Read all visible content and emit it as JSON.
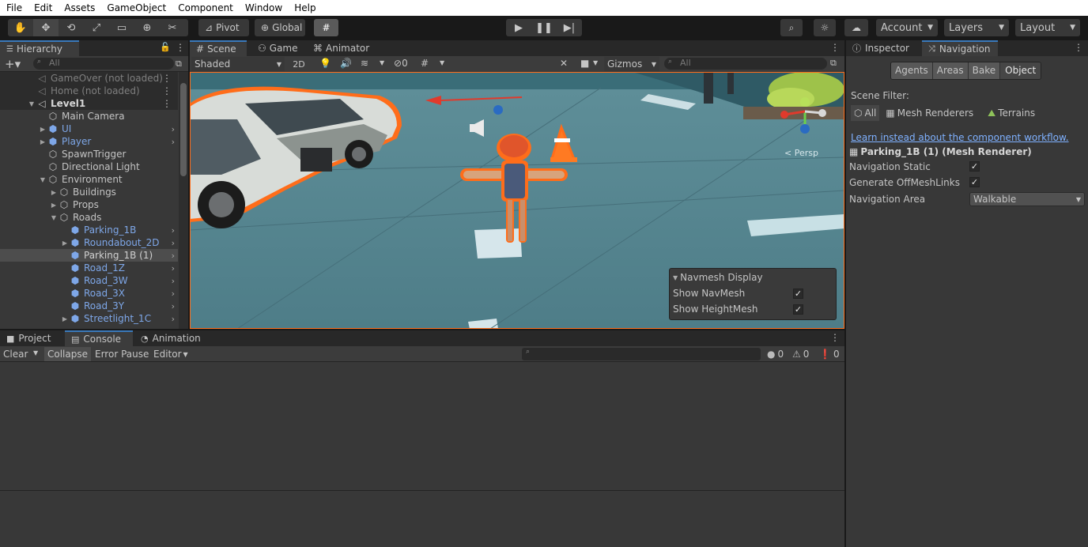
{
  "menu": [
    "File",
    "Edit",
    "Assets",
    "GameObject",
    "Component",
    "Window",
    "Help"
  ],
  "toolbar": {
    "pivot_label": "Pivot",
    "global_label": "Global",
    "account_label": "Account",
    "layers_label": "Layers",
    "layout_label": "Layout"
  },
  "hierarchy": {
    "tab_label": "Hierarchy",
    "search_placeholder": "All",
    "rows": [
      {
        "label": "GameOver (not loaded)"
      },
      {
        "label": "Home (not loaded)"
      },
      {
        "label": "Level1"
      },
      {
        "label": "Main Camera"
      },
      {
        "label": "UI"
      },
      {
        "label": "Player"
      },
      {
        "label": "SpawnTrigger"
      },
      {
        "label": "Directional Light"
      },
      {
        "label": "Environment"
      },
      {
        "label": "Buildings"
      },
      {
        "label": "Props"
      },
      {
        "label": "Roads"
      },
      {
        "label": "Parking_1B"
      },
      {
        "label": "Roundabout_2D"
      },
      {
        "label": "Parking_1B (1)"
      },
      {
        "label": "Road_1Z"
      },
      {
        "label": "Road_3W"
      },
      {
        "label": "Road_3X"
      },
      {
        "label": "Road_3Y"
      },
      {
        "label": "Streetlight_1C"
      }
    ]
  },
  "scene": {
    "tabs": [
      "Scene",
      "Game",
      "Animator"
    ],
    "shading_mode": "Shaded",
    "mode_2d": "2D",
    "hidden_count": "0",
    "gizmos_label": "Gizmos",
    "search_placeholder": "All",
    "persp_label": "< Persp",
    "navmesh_panel": {
      "title": "Navmesh Display",
      "show_navmesh": "Show NavMesh",
      "show_heightmesh": "Show HeightMesh"
    }
  },
  "inspector": {
    "tabs": [
      "Inspector",
      "Navigation"
    ],
    "nav_tabs": [
      "Agents",
      "Areas",
      "Bake",
      "Object"
    ],
    "scene_filter_label": "Scene Filter:",
    "filters": [
      "All",
      "Mesh Renderers",
      "Terrains"
    ],
    "learn_link": "Learn instead about the component workflow.",
    "object_title": "Parking_1B (1) (Mesh Renderer)",
    "nav_static_label": "Navigation Static",
    "gen_offmesh_label": "Generate OffMeshLinks",
    "nav_area_label": "Navigation Area",
    "nav_area_value": "Walkable"
  },
  "console": {
    "tabs": [
      "Project",
      "Console",
      "Animation"
    ],
    "clear_label": "Clear",
    "collapse_label": "Collapse",
    "error_pause_label": "Error Pause",
    "editor_label": "Editor",
    "log_count": "0",
    "warn_count": "0",
    "error_count": "0"
  },
  "colors": {
    "accent": "#3a79bb",
    "prefab_blue": "#7ea7e8",
    "selection_outline": "#ff6d1a",
    "link": "#7fb1ff"
  }
}
